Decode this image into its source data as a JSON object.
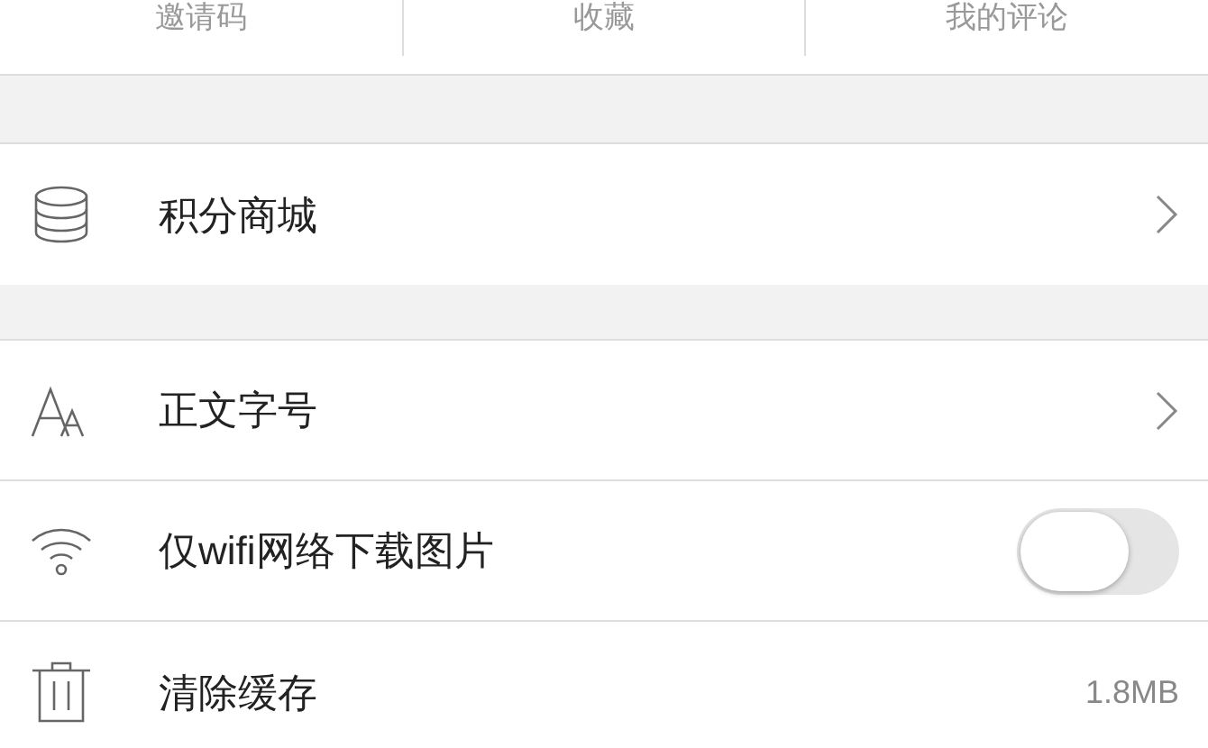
{
  "tabs": [
    {
      "label": "邀请码"
    },
    {
      "label": "收藏"
    },
    {
      "label": "我的评论"
    }
  ],
  "sections": [
    {
      "items": [
        {
          "label": "积分商城",
          "kind": "link"
        }
      ]
    },
    {
      "items": [
        {
          "label": "正文字号",
          "kind": "link"
        },
        {
          "label": "仅wifi网络下载图片",
          "kind": "toggle",
          "on": false
        },
        {
          "label": "清除缓存",
          "kind": "value",
          "value": "1.8MB"
        }
      ]
    }
  ]
}
